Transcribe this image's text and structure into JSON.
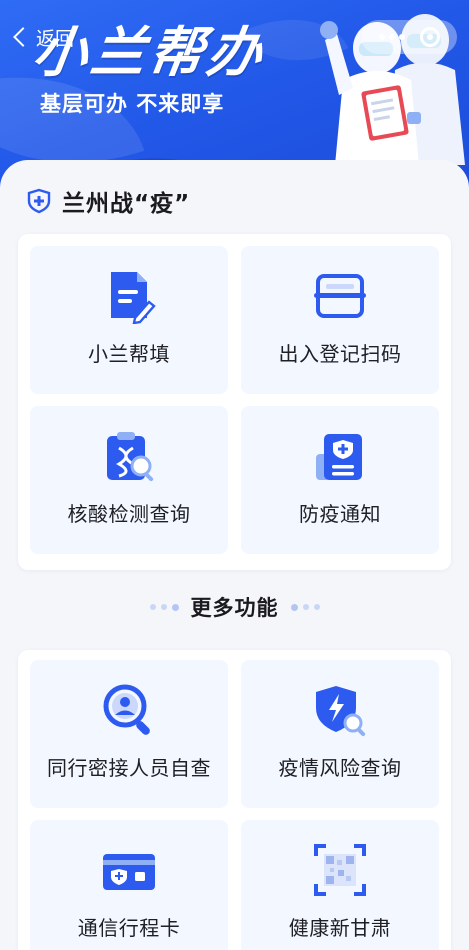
{
  "header": {
    "back_label": "返回",
    "brand_title": "小兰帮办",
    "slogan": "基层可办 不来即享"
  },
  "section_main": {
    "title": "兰州战“疫”",
    "tiles": [
      {
        "label": "小兰帮填",
        "icon": "form-fill-icon"
      },
      {
        "label": "出入登记扫码",
        "icon": "scan-frame-icon"
      },
      {
        "label": "核酸检测查询",
        "icon": "nucleic-test-icon"
      },
      {
        "label": "防疫通知",
        "icon": "epidemic-notice-icon"
      }
    ]
  },
  "section_more": {
    "title": "更多功能",
    "tiles": [
      {
        "label": "同行密接人员自查",
        "icon": "contact-search-icon"
      },
      {
        "label": "疫情风险查询",
        "icon": "risk-shield-icon"
      },
      {
        "label": "通信行程卡",
        "icon": "travel-card-icon"
      },
      {
        "label": "健康新甘肃",
        "icon": "health-qr-icon"
      }
    ]
  },
  "colors": {
    "brand_blue": "#2258e8",
    "icon_blue": "#2d5bf0",
    "tile_bg": "#f3f7ff"
  }
}
